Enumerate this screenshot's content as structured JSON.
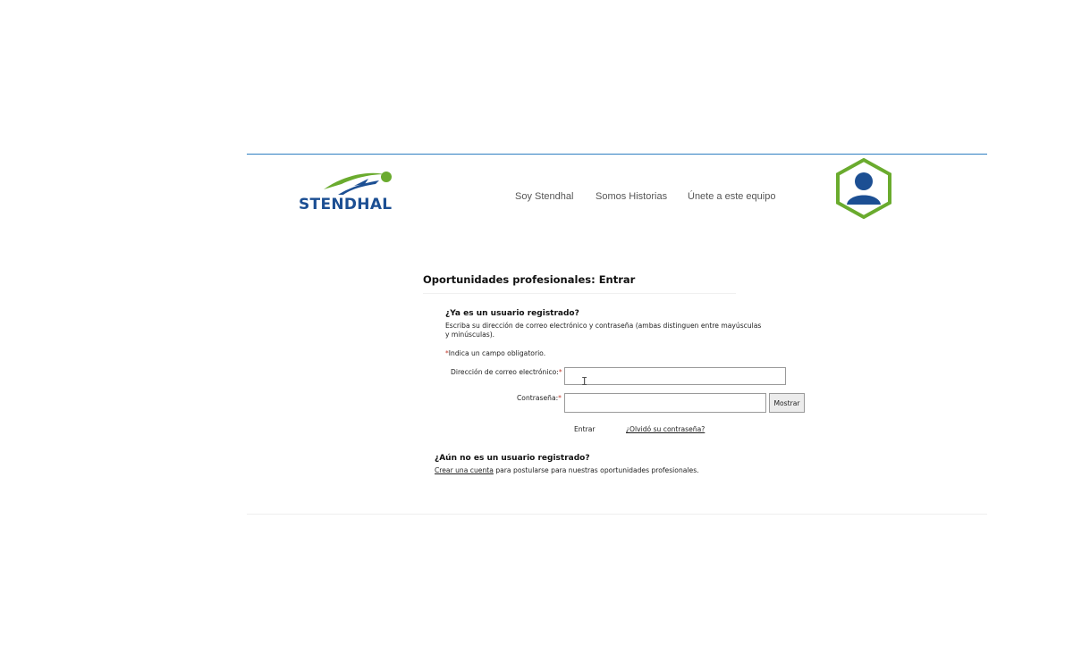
{
  "header": {
    "logo_text": "STENDHAL",
    "nav": [
      "Soy Stendhal",
      "Somos Historias",
      "Únete a este equipo"
    ]
  },
  "login": {
    "title": "Oportunidades profesionales: Entrar",
    "registered_heading": "¿Ya es un usuario registrado?",
    "instructions": "Escriba su dirección de correo electrónico y contraseña (ambas distinguen entre mayúsculas y minúsculas).",
    "required_star": "*",
    "required_note": "Indica un campo obligatorio.",
    "email_label": "Dirección de correo electrónico:",
    "password_label": "Contraseña:",
    "email_value": "",
    "password_value": "",
    "show_button": "Mostrar",
    "enter_button": "Entrar",
    "forgot_link": "¿Olvidó su contraseña?"
  },
  "signup": {
    "heading": "¿Aún no es un usuario registrado?",
    "create_link": "Crear una cuenta",
    "rest_text": " para postularse para nuestras oportunidades profesionales."
  },
  "colors": {
    "brand_blue": "#1c4f93",
    "brand_green": "#6aab2e",
    "rule_blue": "#2f7fc1"
  },
  "icons": [
    "stendhal-logo-swoosh",
    "user-avatar-hexagon-icon",
    "text-cursor-icon"
  ]
}
